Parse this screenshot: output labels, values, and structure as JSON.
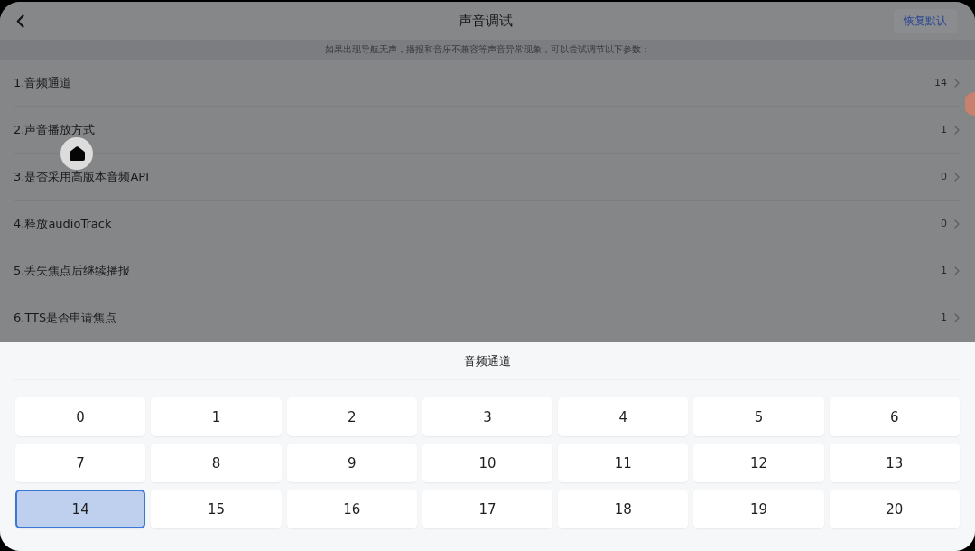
{
  "header": {
    "title": "声音调试",
    "reset_button": "恢复默认"
  },
  "notice": "如果出现导航无声，播报和音乐不兼容等声音异常现象，可以尝试调节以下参数：",
  "settings": [
    {
      "label": "1.音频通道",
      "value": "14"
    },
    {
      "label": "2.声音播放方式",
      "value": "1"
    },
    {
      "label": "3.是否采用高版本音频API",
      "value": "0"
    },
    {
      "label": "4.释放audioTrack",
      "value": "0"
    },
    {
      "label": "5.丢失焦点后继续播报",
      "value": "1"
    },
    {
      "label": "6.TTS是否申请焦点",
      "value": "1"
    }
  ],
  "picker": {
    "title": "音频通道",
    "options": [
      {
        "label": "0",
        "selected": false
      },
      {
        "label": "1",
        "selected": false
      },
      {
        "label": "2",
        "selected": false
      },
      {
        "label": "3",
        "selected": false
      },
      {
        "label": "4",
        "selected": false
      },
      {
        "label": "5",
        "selected": false
      },
      {
        "label": "6",
        "selected": false
      },
      {
        "label": "7",
        "selected": false
      },
      {
        "label": "8",
        "selected": false
      },
      {
        "label": "9",
        "selected": false
      },
      {
        "label": "10",
        "selected": false
      },
      {
        "label": "11",
        "selected": false
      },
      {
        "label": "12",
        "selected": false
      },
      {
        "label": "13",
        "selected": false
      },
      {
        "label": "14",
        "selected": true
      },
      {
        "label": "15",
        "selected": false
      },
      {
        "label": "16",
        "selected": false
      },
      {
        "label": "17",
        "selected": false
      },
      {
        "label": "18",
        "selected": false
      },
      {
        "label": "19",
        "selected": false
      },
      {
        "label": "20",
        "selected": false
      }
    ]
  }
}
